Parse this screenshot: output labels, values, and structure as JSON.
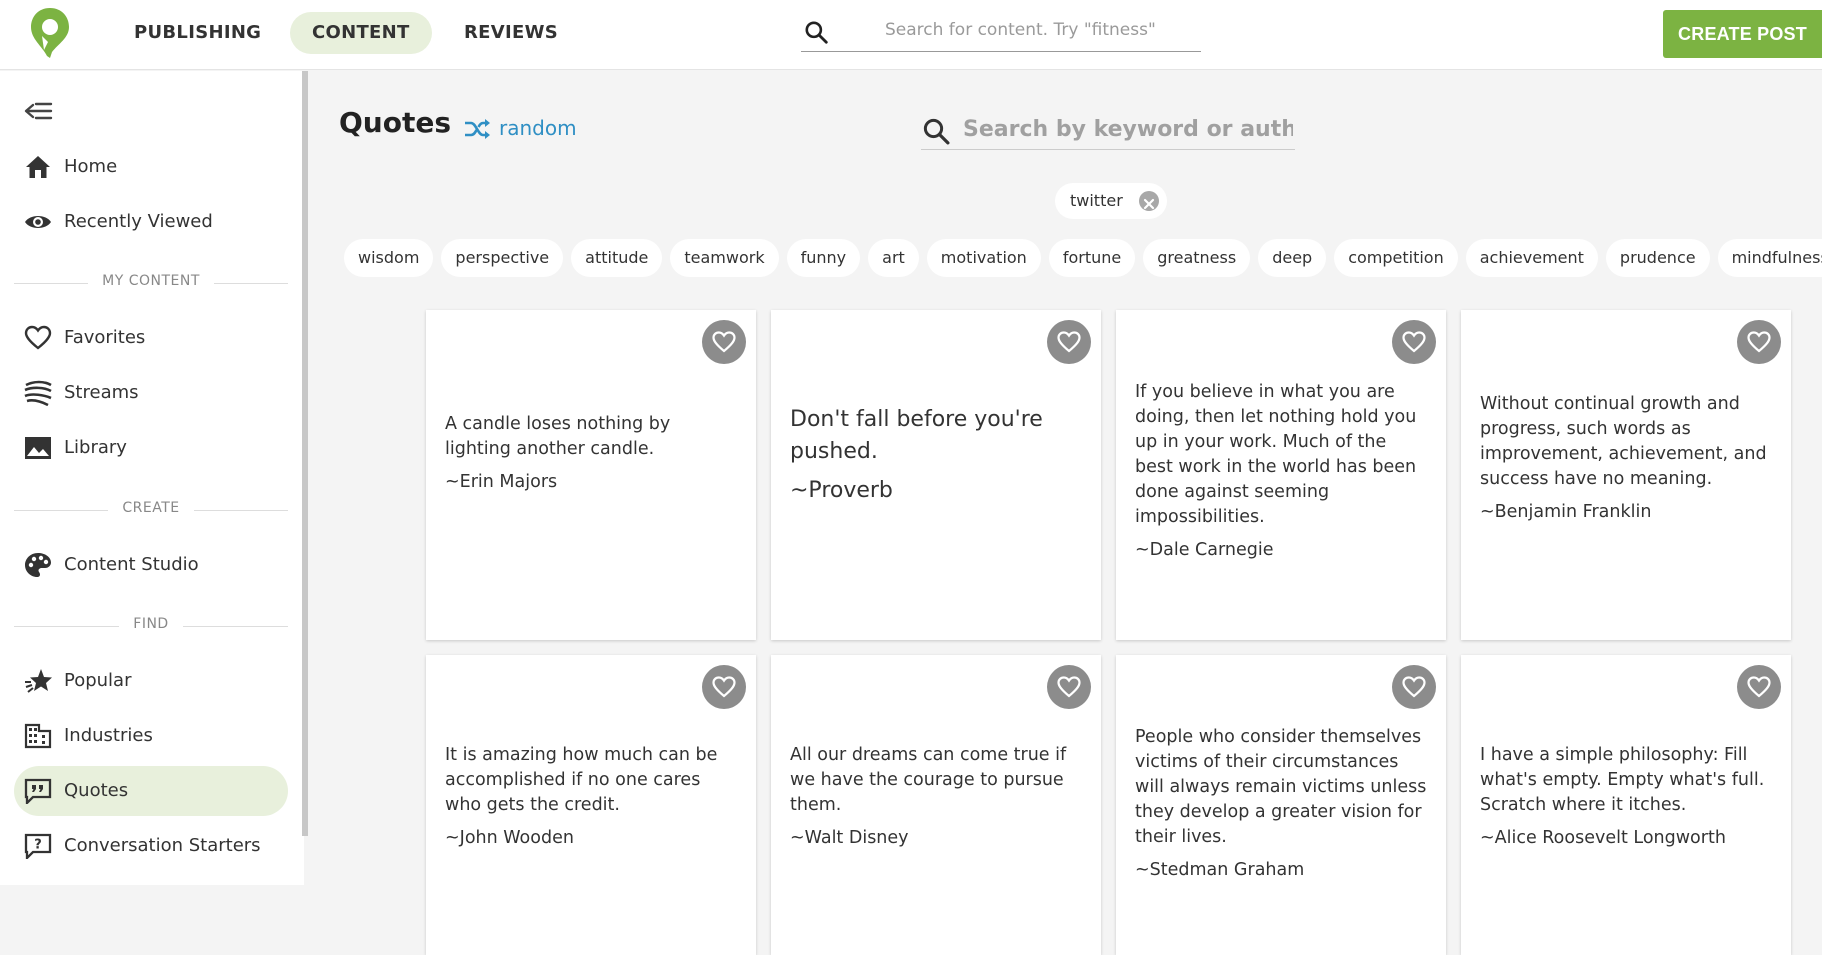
{
  "nav": {
    "tabs": [
      "PUBLISHING",
      "CONTENT",
      "REVIEWS"
    ],
    "active_tab": "CONTENT",
    "search_placeholder": "Search for content. Try \"fitness\"",
    "create_label": "CREATE POST"
  },
  "colors": {
    "brand_green": "#7cb342",
    "active_bg": "#e8f0dc",
    "link_blue": "#2f8fc4"
  },
  "sidebar": {
    "items_top": [
      {
        "label": "Home",
        "icon": "home-icon"
      },
      {
        "label": "Recently Viewed",
        "icon": "eye-icon"
      }
    ],
    "my_content_header": "MY CONTENT",
    "my_content": [
      {
        "label": "Favorites",
        "icon": "heart-icon"
      },
      {
        "label": "Streams",
        "icon": "streams-icon"
      },
      {
        "label": "Library",
        "icon": "image-icon"
      }
    ],
    "create_header": "CREATE",
    "create": [
      {
        "label": "Content Studio",
        "icon": "palette-icon"
      }
    ],
    "find_header": "FIND",
    "find": [
      {
        "label": "Popular",
        "icon": "star-icon"
      },
      {
        "label": "Industries",
        "icon": "building-icon"
      },
      {
        "label": "Quotes",
        "icon": "quote-bubble-icon",
        "active": true
      },
      {
        "label": "Conversation Starters",
        "icon": "question-bubble-icon"
      }
    ]
  },
  "main": {
    "title": "Quotes",
    "random_label": "random",
    "search_placeholder": "Search by keyword or author",
    "active_tag": "twitter",
    "tags": [
      "wisdom",
      "perspective",
      "attitude",
      "teamwork",
      "funny",
      "art",
      "motivation",
      "fortune",
      "greatness",
      "deep",
      "competition",
      "achievement",
      "prudence",
      "mindfulness"
    ],
    "quotes": [
      {
        "text": "A candle loses nothing by lighting another candle.",
        "author": "~Erin Majors"
      },
      {
        "text": "Don't fall before you're pushed.",
        "author": "~Proverb"
      },
      {
        "text": "If you believe in what you are doing, then let nothing hold you up in your work. Much of the best work in the world has been done against seeming impossibilities.",
        "author": "~Dale Carnegie"
      },
      {
        "text": "Without continual growth and progress, such words as improvement, achievement, and success have no meaning.",
        "author": "~Benjamin Franklin"
      },
      {
        "text": "It is amazing how much can be accomplished if no one cares who gets the credit.",
        "author": "~John Wooden"
      },
      {
        "text": "All our dreams can come true if we have the courage to pursue them.",
        "author": "~Walt Disney"
      },
      {
        "text": "People who consider themselves victims of their circumstances will always remain victims unless they develop a greater vision for their lives.",
        "author": "~Stedman Graham"
      },
      {
        "text": "I have a simple philosophy: Fill what's empty. Empty what's full. Scratch where it itches.",
        "author": "~Alice Roosevelt Longworth"
      }
    ]
  }
}
